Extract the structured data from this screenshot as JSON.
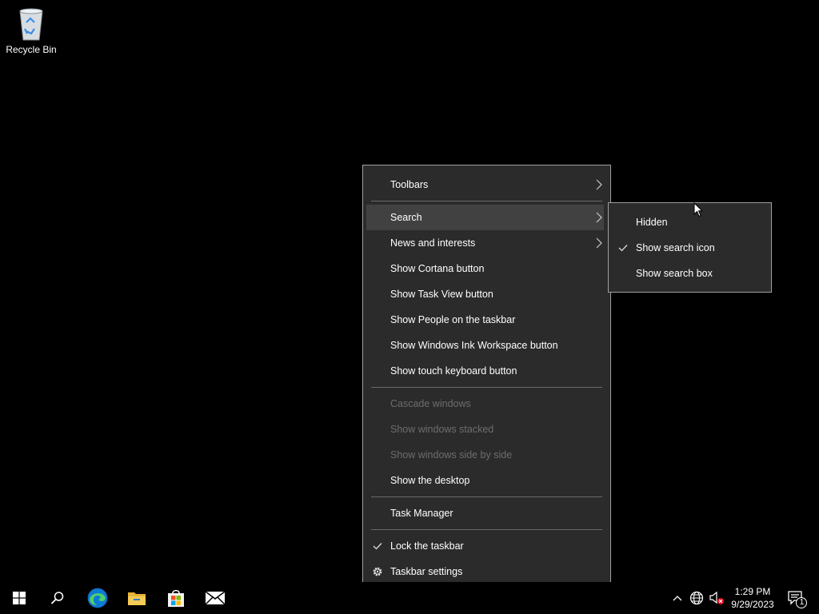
{
  "desktop": {
    "recycle_bin_label": "Recycle Bin"
  },
  "context_menu": {
    "items": [
      {
        "label": "Toolbars",
        "submenu": true
      },
      {
        "label": "Search",
        "submenu": true,
        "highlighted": true
      },
      {
        "label": "News and interests",
        "submenu": true
      },
      {
        "label": "Show Cortana button"
      },
      {
        "label": "Show Task View button"
      },
      {
        "label": "Show People on the taskbar"
      },
      {
        "label": "Show Windows Ink Workspace button"
      },
      {
        "label": "Show touch keyboard button"
      },
      {
        "label": "Cascade windows",
        "disabled": true
      },
      {
        "label": "Show windows stacked",
        "disabled": true
      },
      {
        "label": "Show windows side by side",
        "disabled": true
      },
      {
        "label": "Show the desktop"
      },
      {
        "label": "Task Manager"
      },
      {
        "label": "Lock the taskbar",
        "checked": true
      },
      {
        "label": "Taskbar settings",
        "icon": "gear-icon"
      }
    ]
  },
  "search_submenu": {
    "items": [
      {
        "label": "Hidden"
      },
      {
        "label": "Show search icon",
        "checked": true
      },
      {
        "label": "Show search box"
      }
    ]
  },
  "taskbar": {
    "pinned": [
      "start-icon",
      "search-icon",
      "edge-icon",
      "file-explorer-icon",
      "store-icon",
      "mail-icon"
    ],
    "clock_time": "1:29 PM",
    "clock_date": "9/29/2023",
    "notification_count": "1"
  },
  "colors": {
    "menu_bg": "#2b2b2b",
    "menu_highlight": "#414141",
    "disabled_text": "#6d6d6d",
    "desktop_bg": "#000000"
  }
}
